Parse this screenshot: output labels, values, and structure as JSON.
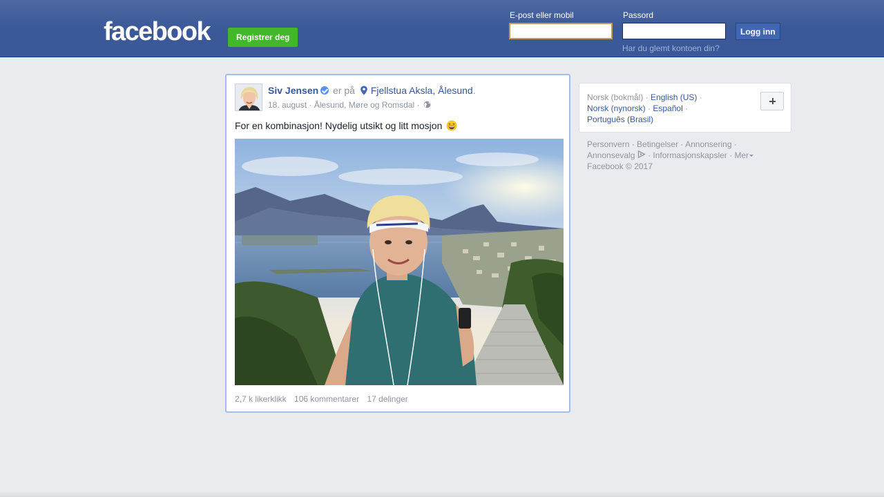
{
  "header": {
    "logo": "facebook",
    "register_label": "Registrer deg",
    "email_label": "E-post eller mobil",
    "email_value": "",
    "password_label": "Passord",
    "password_value": "",
    "login_label": "Logg inn",
    "forgot_label": "Har du glemt kontoen din?"
  },
  "post": {
    "author": "Siv Jensen",
    "action": "er på",
    "location": "Fjellstua Aksla, Ålesund",
    "location_suffix": ".",
    "date": "18. august",
    "place": "Ålesund, Møre og Romsdal",
    "meta_sep": "·",
    "text": "For en kombinasjon! Nydelig utsikt og litt mosjon",
    "likes": "2,7 k likerklikk",
    "comments": "106 kommentarer",
    "shares": "17 delinger"
  },
  "languages": {
    "current": "Norsk (bokmål)",
    "items": [
      "English (US)",
      "Norsk (nynorsk)",
      "Español",
      "Português (Brasil)"
    ],
    "sep": "·"
  },
  "footer": {
    "links": [
      "Personvern",
      "Betingelser",
      "Annonsering",
      "Annonsevalg",
      "Informasjonskapsler",
      "Mer"
    ],
    "copyright": "Facebook © 2017"
  },
  "colors": {
    "topbar": "#3b5998",
    "link": "#365899",
    "register": "#42b72a",
    "post_border": "#a3bdf0"
  }
}
